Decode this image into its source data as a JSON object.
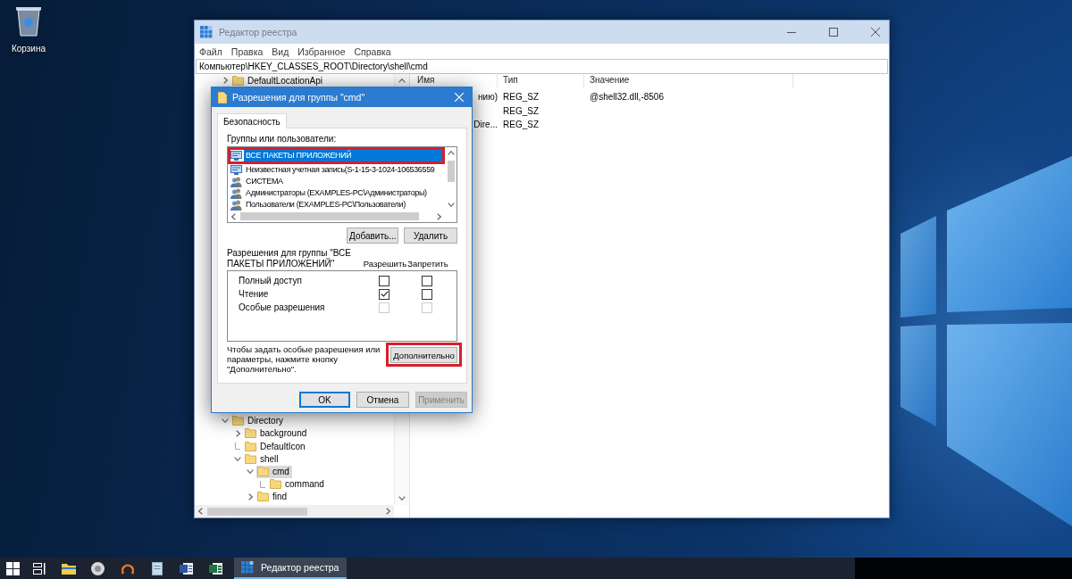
{
  "desktop": {
    "icons": [
      {
        "label": "Корзина"
      }
    ]
  },
  "registry": {
    "title": "Редактор реестра",
    "menu": [
      "Файл",
      "Правка",
      "Вид",
      "Избранное",
      "Справка"
    ],
    "address": "Компьютер\\HKEY_CLASSES_ROOT\\Directory\\shell\\cmd",
    "tree_top": [
      {
        "label": "DefaultLocationApi",
        "expandable": true,
        "expanded": false,
        "selected": false
      }
    ],
    "tree_bottom": [
      {
        "label": "Directory",
        "expandable": true,
        "expanded": true,
        "selected": false,
        "children": [
          {
            "label": "background",
            "expandable": true,
            "expanded": false,
            "selected": false
          },
          {
            "label": "DefaultIcon",
            "expandable": false,
            "selected": false
          },
          {
            "label": "shell",
            "expandable": true,
            "expanded": true,
            "selected": false,
            "children": [
              {
                "label": "cmd",
                "expandable": true,
                "expanded": true,
                "selected": true,
                "children": [
                  {
                    "label": "command",
                    "expandable": false,
                    "selected": false
                  }
                ]
              },
              {
                "label": "find",
                "expandable": true,
                "expanded": false,
                "selected": false
              }
            ]
          }
        ]
      }
    ],
    "columns": [
      "Имя",
      "Тип",
      "Значение"
    ],
    "values": [
      {
        "name": "нию)",
        "type": "REG_SZ",
        "data": "@shell32.dll,-8506"
      },
      {
        "type": "REG_SZ"
      },
      {
        "name": "Dire...",
        "type": "REG_SZ"
      }
    ]
  },
  "dialog": {
    "title": "Разрешения для группы \"cmd\"",
    "tabs": [
      {
        "label": "Безопасность",
        "selected": true
      }
    ],
    "groups_label": "Группы или пользователи:",
    "principals": [
      {
        "name": "ВСЕ ПАКЕТЫ ПРИЛОЖЕНИЙ",
        "kind": "package",
        "selected": true,
        "highlighted": true
      },
      {
        "name": "Неизвестная учетная запись(S-1-15-3-1024-106536559",
        "kind": "package",
        "selected": false,
        "highlighted": false
      },
      {
        "name": "СИСТЕМА",
        "kind": "group",
        "selected": false,
        "highlighted": false
      },
      {
        "name": "Администраторы (EXAMPLES-PC\\Администраторы)",
        "kind": "group",
        "selected": false,
        "highlighted": false
      },
      {
        "name": "Пользователи (EXAMPLES-PC\\Пользователи)",
        "kind": "group",
        "selected": false,
        "highlighted": false
      }
    ],
    "principal_buttons": [
      "Добавить...",
      "Удалить"
    ],
    "permissions_label": "Разрешения для группы \"ВСЕ ПАКЕТЫ ПРИЛОЖЕНИЙ\"",
    "permission_columns": [
      "Разрешить",
      "Запретить"
    ],
    "permissions": [
      {
        "name": "Полный доступ",
        "allow": false,
        "deny": false,
        "disabled": false
      },
      {
        "name": "Чтение",
        "allow": true,
        "deny": false,
        "disabled": false
      },
      {
        "name": "Особые разрешения",
        "allow": false,
        "deny": false,
        "disabled": true
      }
    ],
    "advanced_hint": "Чтобы задать особые разрешения или параметры, нажмите кнопку \"Дополнительно\".",
    "advanced_button": {
      "label": "Дополнительно",
      "highlighted": true
    },
    "buttons": [
      {
        "label": "OK",
        "default": true,
        "disabled": false
      },
      {
        "label": "Отмена",
        "default": false,
        "disabled": false
      },
      {
        "label": "Применить",
        "default": false,
        "disabled": true
      }
    ]
  },
  "taskbar": {
    "windows": [
      {
        "title": "Редактор реестра",
        "active": true
      }
    ]
  }
}
